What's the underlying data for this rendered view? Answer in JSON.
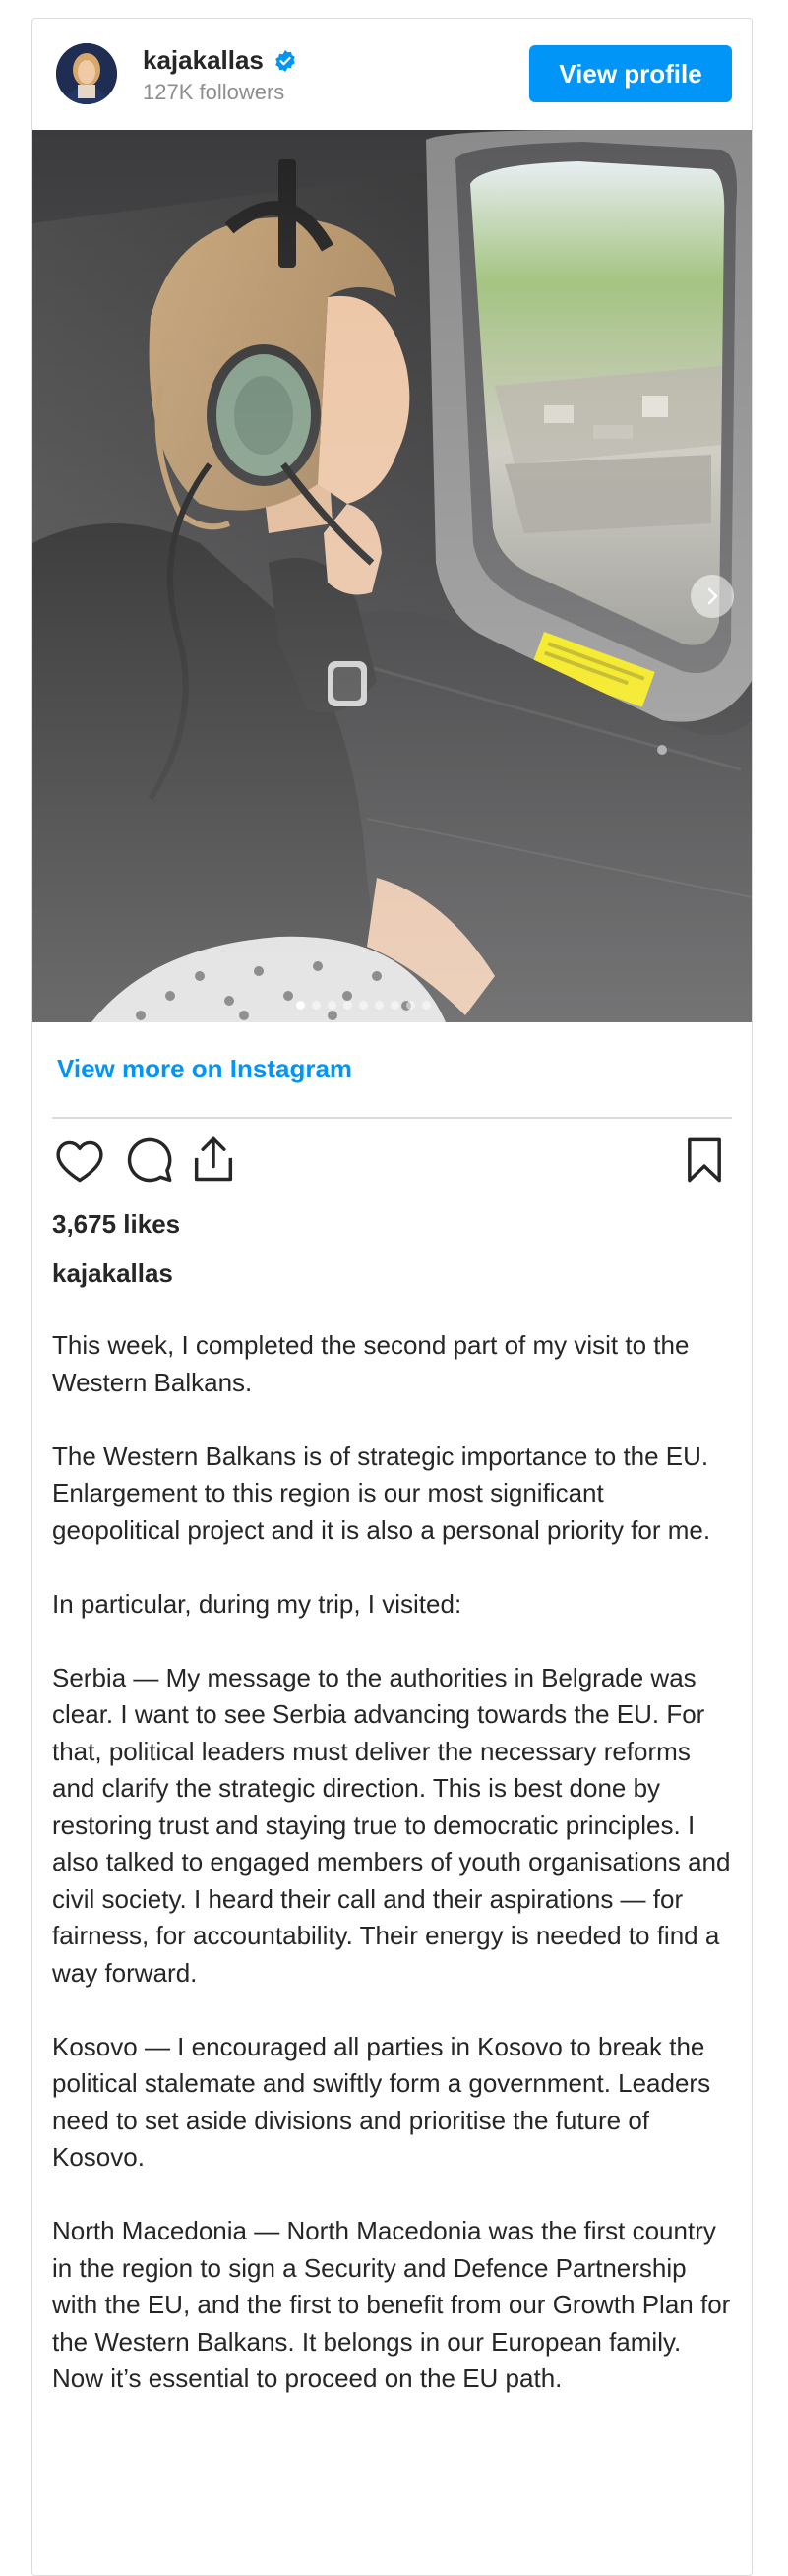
{
  "header": {
    "username": "kajakallas",
    "followers": "127K followers",
    "view_profile_label": "View profile",
    "verified_color": "#0095f6"
  },
  "post": {
    "slide_count": 9,
    "active_slide": 1,
    "view_more_label": "View more on Instagram",
    "likes": "3,675 likes",
    "caption_user": "kajakallas",
    "caption_paragraphs": [
      "This week, I completed the second part of my visit to the Western Balkans.",
      "The Western Balkans is of strategic importance to the EU. Enlargement to this region is our most significant geopolitical project and it is also a personal priority for me.",
      "In particular, during my trip, I visited:",
      "Serbia — My message to the authorities in Belgrade was clear. I want to see Serbia advancing towards the EU. For that, political leaders must deliver the necessary reforms and clarify the strategic direction. This is best done by restoring trust and staying true to democratic principles. I also talked to engaged members of youth organisations and civil society. I heard their call and their aspirations — for fairness, for accountability. Their energy is needed to find a way forward.",
      "Kosovo — I encouraged all parties in Kosovo to break the political stalemate and swiftly form a government. Leaders need to set aside divisions and prioritise the future of Kosovo.",
      "North Macedonia — North Macedonia was the first country in the region to sign a Security and Defence Partnership with the EU, and the first to benefit from our Growth Plan for the Western Balkans. It belongs in our European family. Now it’s essential to proceed on the EU path."
    ]
  },
  "icons": {
    "like": "heart-icon",
    "comment": "comment-icon",
    "share": "share-icon",
    "save": "bookmark-icon",
    "next": "chevron-right-icon",
    "verified": "verified-badge-icon"
  },
  "colors": {
    "accent": "#0095f6",
    "text": "#262626",
    "muted": "#8e8e8e",
    "border": "#dbdbdb"
  }
}
